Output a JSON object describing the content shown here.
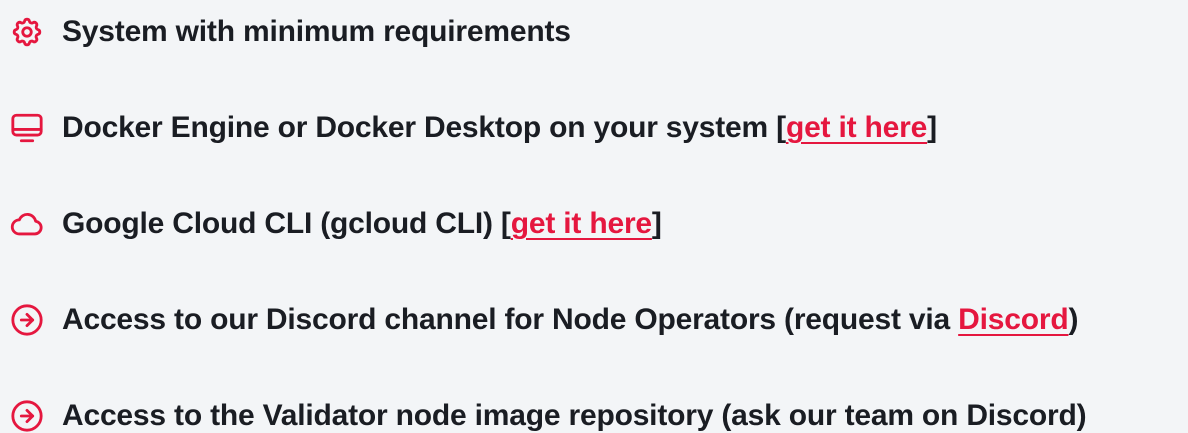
{
  "accent_color": "#e5173f",
  "requirements": [
    {
      "icon": "gear-icon",
      "text": "System with minimum requirements"
    },
    {
      "icon": "monitor-icon",
      "before": "Docker Engine or Docker Desktop on your system [",
      "link": "get it here",
      "after": "]"
    },
    {
      "icon": "cloud-icon",
      "before": "Google Cloud CLI (gcloud CLI) [",
      "link": "get it here",
      "after": "]"
    },
    {
      "icon": "arrow-right-circle-icon",
      "before": "Access to our Discord channel for Node Operators (request via ",
      "link": "Discord",
      "after": ")"
    },
    {
      "icon": "arrow-right-circle-icon",
      "text": "Access to the Validator node image repository (ask our team on Discord)"
    }
  ]
}
